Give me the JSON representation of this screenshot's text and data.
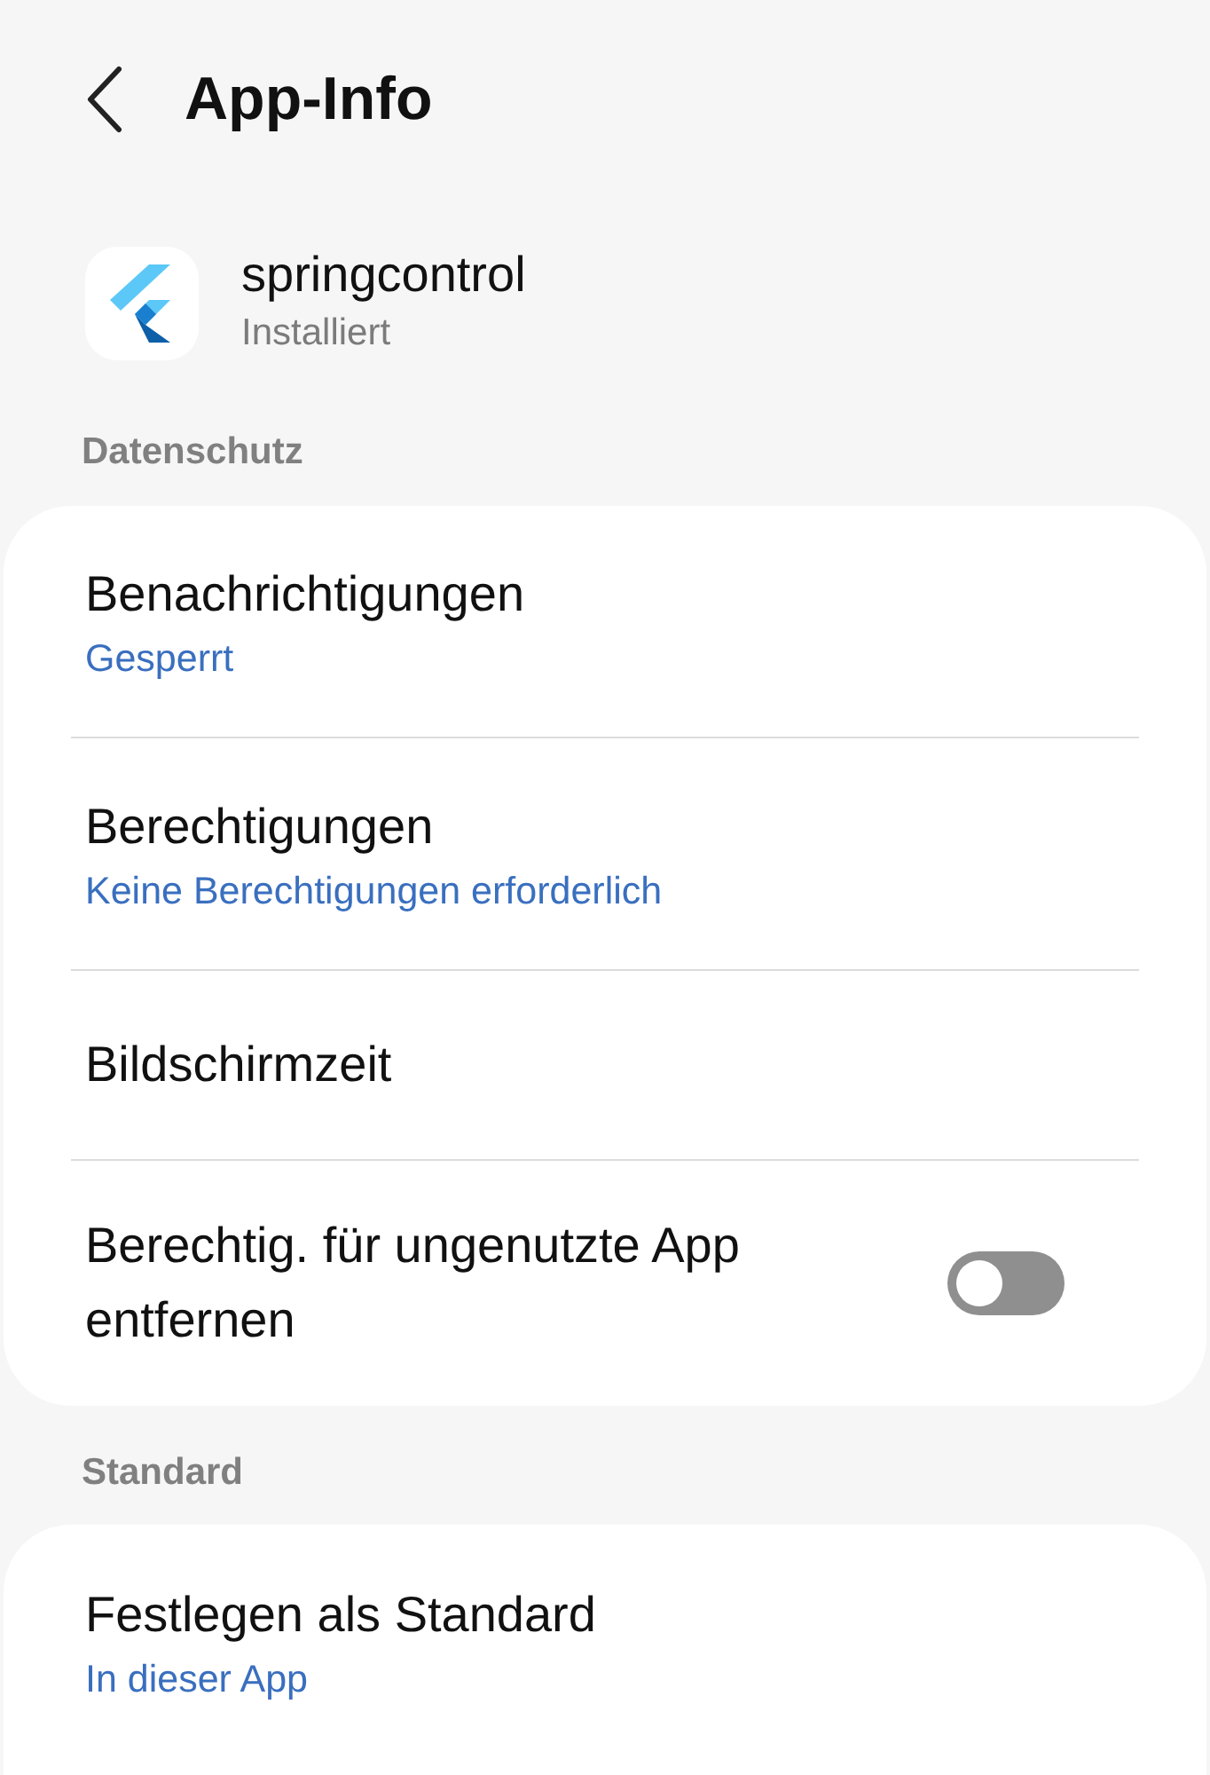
{
  "header": {
    "title": "App-Info"
  },
  "app": {
    "name": "springcontrol",
    "status": "Installiert"
  },
  "sections": [
    {
      "title": "Datenschutz",
      "items": [
        {
          "kind": "link",
          "title": "Benachrichtigungen",
          "subtitle": "Gesperrt"
        },
        {
          "kind": "link",
          "title": "Berechtigungen",
          "subtitle": "Keine Berechtigungen erforderlich"
        },
        {
          "kind": "link",
          "title": "Bildschirmzeit"
        },
        {
          "kind": "toggle",
          "title": "Berechtig. für ungenutzte App entfernen",
          "on": false
        }
      ]
    },
    {
      "title": "Standard",
      "items": [
        {
          "kind": "link",
          "title": "Festlegen als Standard",
          "subtitle": "In dieser App"
        }
      ]
    }
  ]
}
